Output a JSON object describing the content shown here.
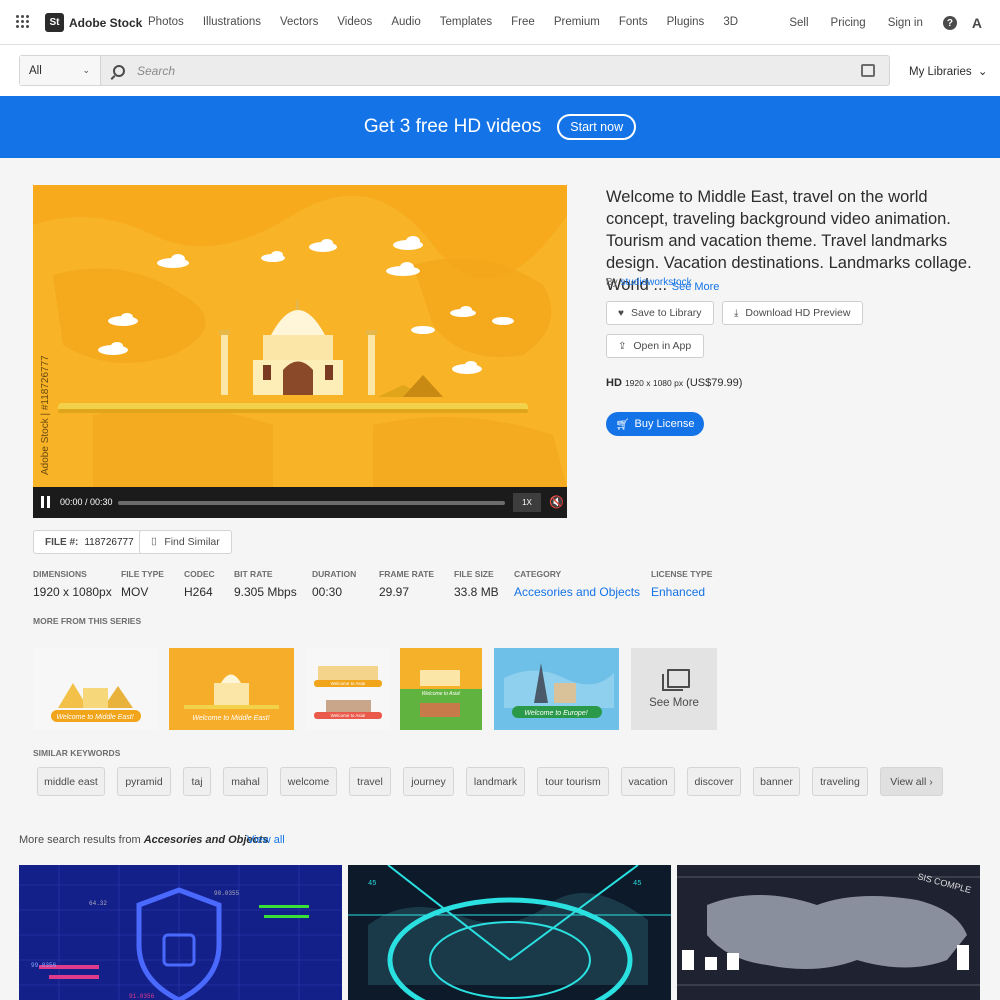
{
  "nav": {
    "logo_mark": "St",
    "logo_text": "Adobe Stock",
    "links": [
      "Photos",
      "Illustrations",
      "Vectors",
      "Videos",
      "Audio",
      "Templates",
      "Free",
      "Premium",
      "Fonts",
      "Plugins",
      "3D"
    ],
    "sell": "Sell",
    "pricing": "Pricing",
    "signin": "Sign in",
    "help_glyph": "?",
    "adobe_glyph": "A"
  },
  "search": {
    "category": "All",
    "placeholder": "Search",
    "my_libraries": "My Libraries"
  },
  "banner": {
    "text": "Get 3 free HD videos",
    "button": "Start now"
  },
  "video": {
    "watermark_side": "Adobe Stock | #118726777",
    "time": "00:00 / 00:30",
    "speed": "1X",
    "progress": 0
  },
  "asset": {
    "title": "Welcome to Middle East, travel on the world concept, traveling background video animation. Tourism and vacation theme. Travel landmarks design. Vacation destinations. Landmarks collage. World ...",
    "see_more": "See More",
    "by": "By",
    "author": "studioworkstock",
    "save": "Save to Library",
    "download": "Download HD Preview",
    "open_app": "Open in App",
    "hd_label": "HD",
    "hd_res": "1920 x 1080 px",
    "hd_price": "(US$79.99)",
    "buy": "Buy License"
  },
  "file": {
    "label": "FILE #:",
    "number": "118726777",
    "find_similar": "Find Similar"
  },
  "meta": [
    {
      "k": "DIMENSIONS",
      "v": "1920 x 1080px"
    },
    {
      "k": "FILE TYPE",
      "v": "MOV"
    },
    {
      "k": "CODEC",
      "v": "H264"
    },
    {
      "k": "BIT RATE",
      "v": "9.305 Mbps"
    },
    {
      "k": "DURATION",
      "v": "00:30"
    },
    {
      "k": "FRAME RATE",
      "v": "29.97"
    },
    {
      "k": "FILE SIZE",
      "v": "33.8 MB"
    },
    {
      "k": "CATEGORY",
      "v": "Accesories and Objects"
    },
    {
      "k": "LICENSE TYPE",
      "v": "Enhanced"
    }
  ],
  "series": {
    "label": "MORE FROM THIS SERIES",
    "thumbs": [
      "Welcome to Middle East!",
      "Welcome to Middle East!",
      "Welcome to Asia!",
      "Welcome to Asia!",
      "Welcome to Europe!"
    ],
    "see_more": "See More"
  },
  "keywords": {
    "label": "SIMILAR KEYWORDS",
    "items": [
      "middle east",
      "pyramid",
      "taj",
      "mahal",
      "welcome",
      "travel",
      "journey",
      "landmark",
      "tour tourism",
      "vacation",
      "discover",
      "banner",
      "traveling"
    ],
    "view_all": "View all ›"
  },
  "more_results": {
    "prefix": "More search results from",
    "category": "Accesories and Objects",
    "view_all": "View all",
    "thumb_labels": {
      "r1a": "64.32",
      "r1b": "90.0355",
      "r1c": "99.0356",
      "r1d": "91.0356",
      "r2a": "45",
      "r2b": "45",
      "r3a": "SIS COMPLE"
    }
  }
}
